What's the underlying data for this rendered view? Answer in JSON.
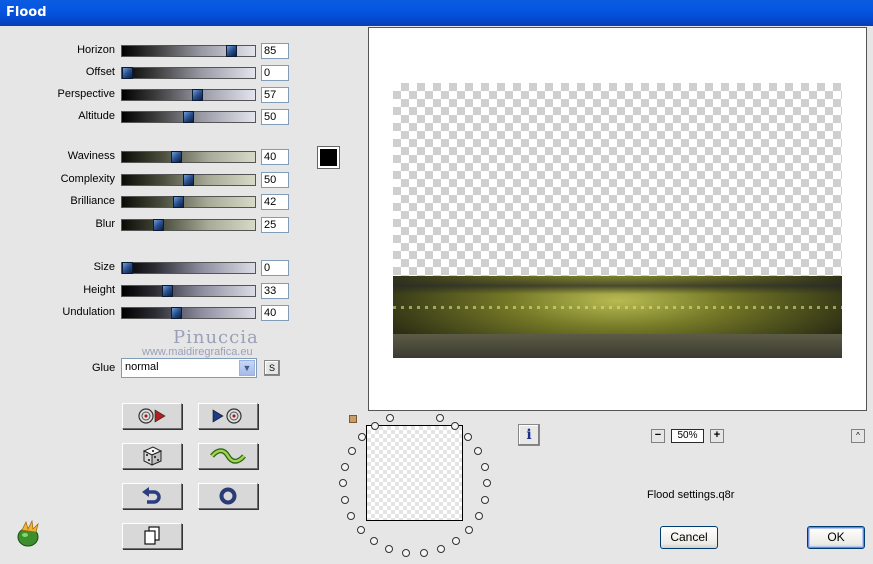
{
  "window": {
    "title": "Flood"
  },
  "sliders_group1": [
    {
      "label": "Horizon",
      "value": "85",
      "level": 0.85,
      "style": "t1"
    },
    {
      "label": "Offset",
      "value": "0",
      "level": 0.0,
      "style": "t1"
    },
    {
      "label": "Perspective",
      "value": "57",
      "level": 0.57,
      "style": "t1"
    },
    {
      "label": "Altitude",
      "value": "50",
      "level": 0.5,
      "style": "t1"
    }
  ],
  "sliders_group2": [
    {
      "label": "Waviness",
      "value": "40",
      "level": 0.4,
      "style": "t2"
    },
    {
      "label": "Complexity",
      "value": "50",
      "level": 0.5,
      "style": "t2"
    },
    {
      "label": "Brilliance",
      "value": "42",
      "level": 0.42,
      "style": "t2"
    },
    {
      "label": "Blur",
      "value": "25",
      "level": 0.25,
      "style": "t2"
    }
  ],
  "sliders_group3": [
    {
      "label": "Size",
      "value": "0",
      "level": 0.0,
      "style": "t3"
    },
    {
      "label": "Height",
      "value": "33",
      "level": 0.33,
      "style": "t3"
    },
    {
      "label": "Undulation",
      "value": "40",
      "level": 0.4,
      "style": "t3"
    }
  ],
  "flood_color": "#000000",
  "watermark": {
    "name": "Pinuccia",
    "url": "www.maidiregrafica.eu"
  },
  "glue": {
    "label": "Glue",
    "selected": "normal",
    "side_button": "S"
  },
  "tool_buttons": [
    {
      "name": "load-preset-button",
      "icon": "disc-arrow-right-icon"
    },
    {
      "name": "save-preset-button",
      "icon": "arrow-disc-right-icon"
    },
    {
      "name": "randomize-button",
      "icon": "dice-icon"
    },
    {
      "name": "wave-button",
      "icon": "wave-icon"
    },
    {
      "name": "undo-button",
      "icon": "undo-arrow-icon"
    },
    {
      "name": "reset-button",
      "icon": "ring-icon"
    },
    {
      "name": "copy-button",
      "icon": "copy-pages-icon"
    }
  ],
  "zoom": {
    "minus": "−",
    "value": "50%",
    "plus": "+"
  },
  "info_label": "i",
  "collapse_label": "^",
  "settings_file": "Flood settings.q8r",
  "buttons": {
    "cancel": "Cancel",
    "ok": "OK"
  }
}
